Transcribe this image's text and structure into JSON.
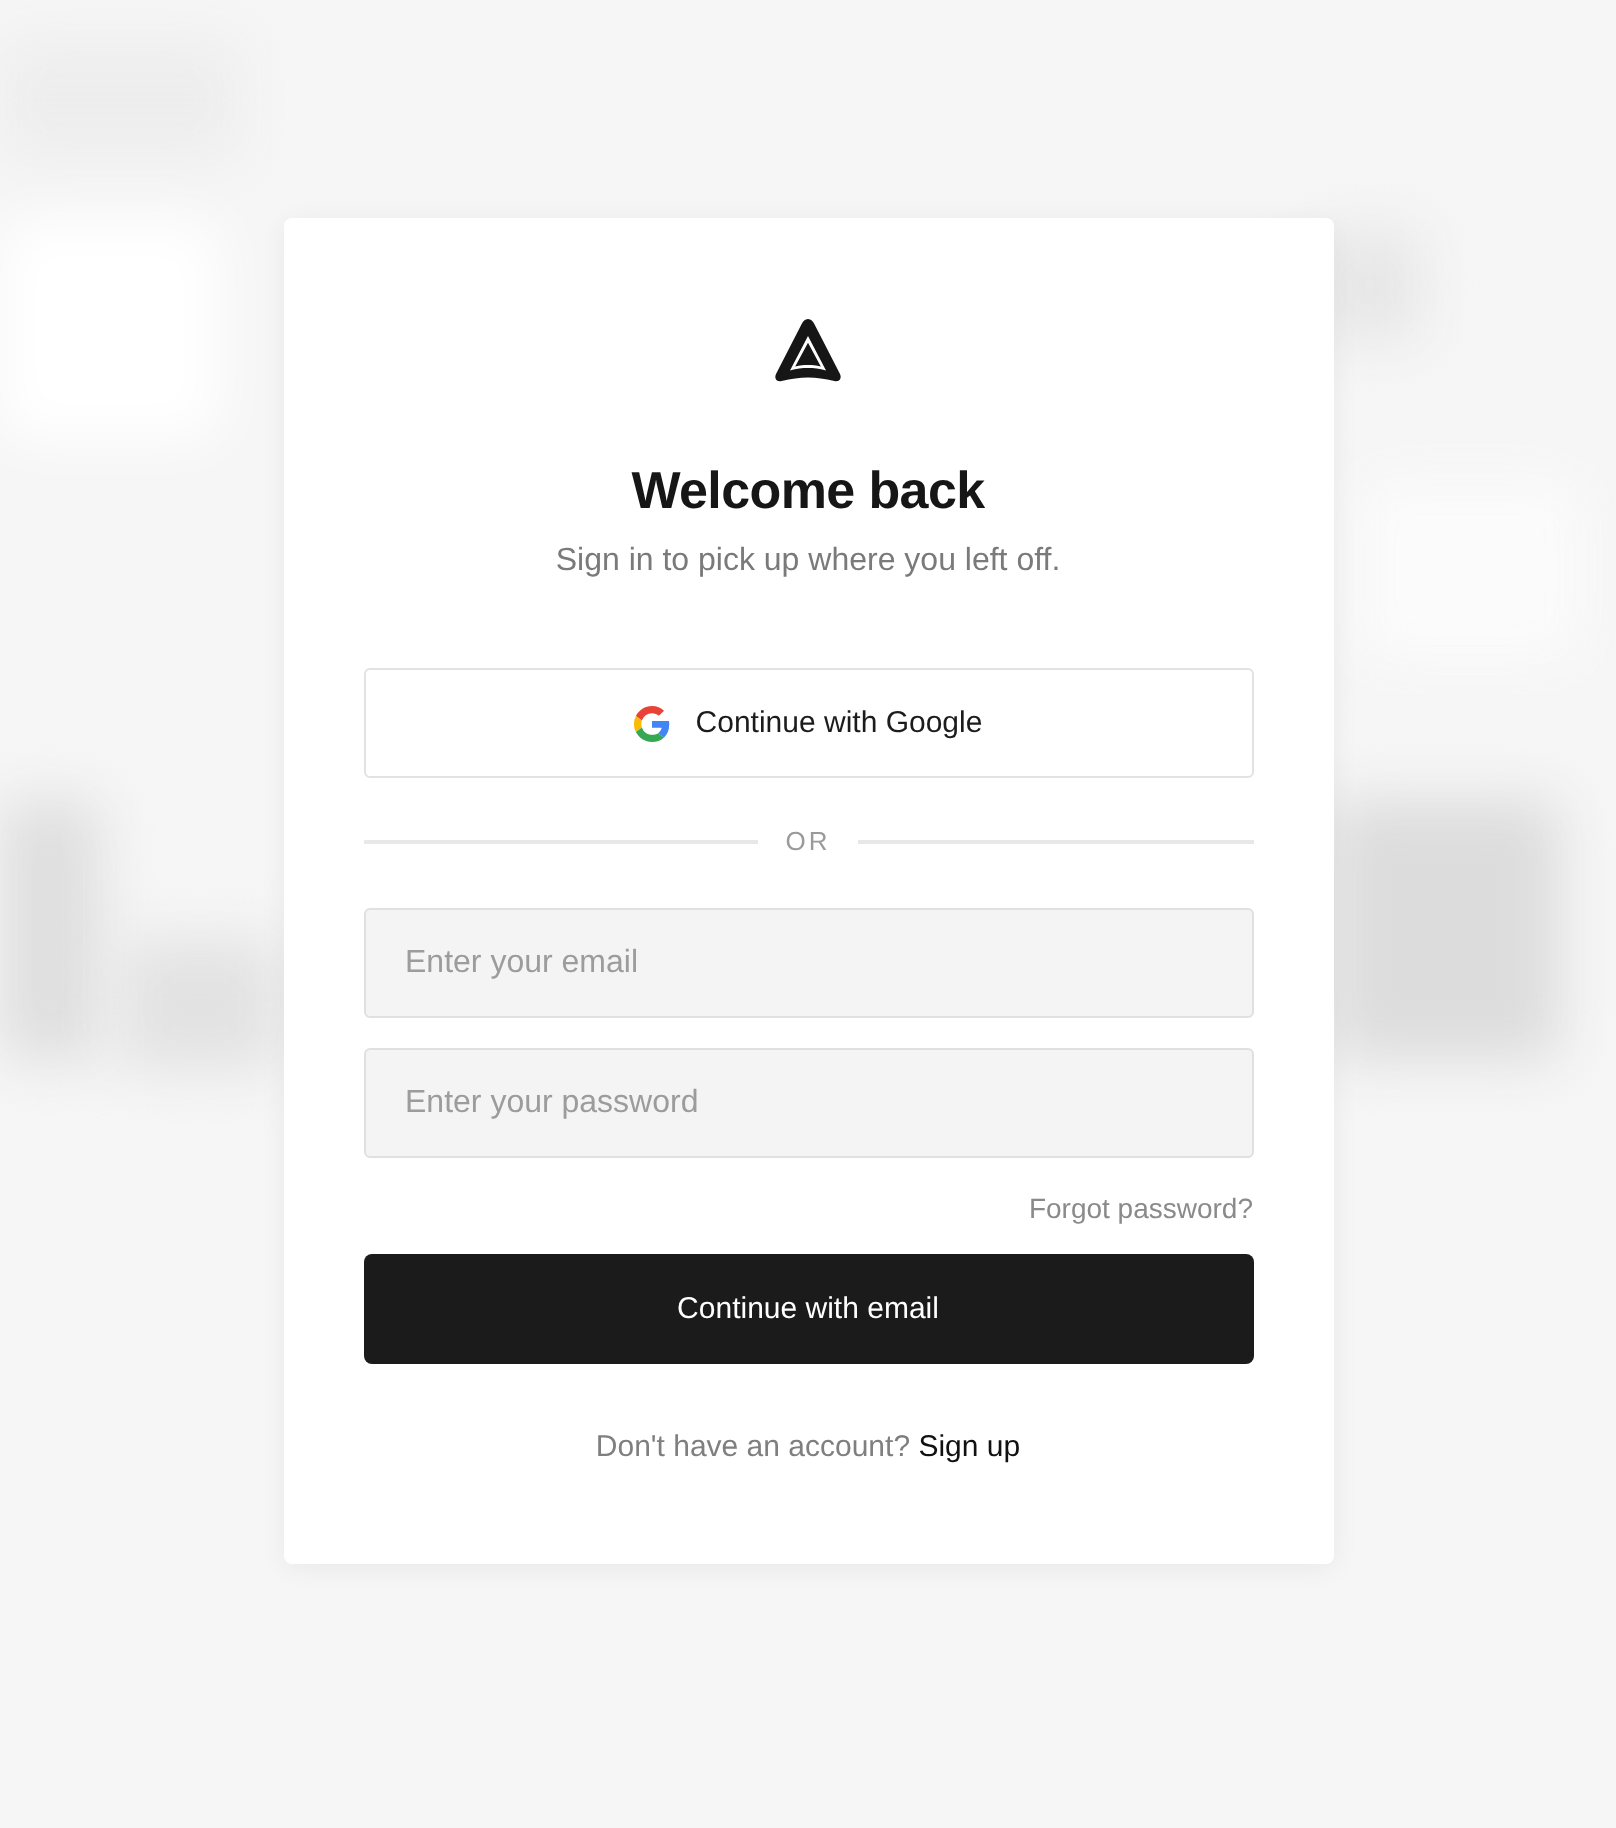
{
  "card": {
    "title": "Welcome back",
    "subtitle": "Sign in to pick up where you left off."
  },
  "google_button": {
    "label": "Continue with Google"
  },
  "divider": {
    "label": "OR"
  },
  "fields": [
    {
      "placeholder": "Enter your email"
    },
    {
      "placeholder": "Enter your password"
    }
  ],
  "forgot_link": {
    "label": "Forgot password?"
  },
  "submit_button": {
    "label": "Continue with email"
  },
  "footer": {
    "prompt": "Don't have an account?",
    "link": "Sign up"
  }
}
